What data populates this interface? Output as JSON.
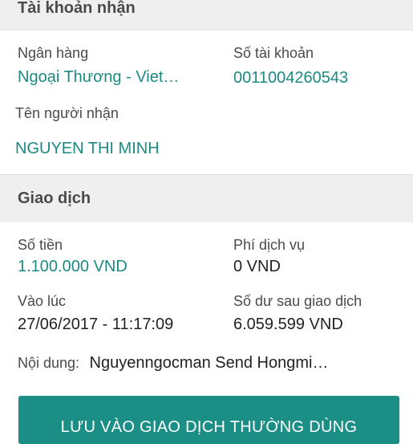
{
  "account_section": {
    "header": "Tài khoản nhận",
    "bank_label": "Ngân hàng",
    "bank_value": "Ngoại Thương - Viet…",
    "account_no_label": "Số tài khoản",
    "account_no_value": "0011004260543",
    "recipient_label": "Tên người nhận",
    "recipient_value": "NGUYEN THI MINH"
  },
  "transaction_section": {
    "header": "Giao dịch",
    "amount_label": "Số tiền",
    "amount_value": "1.100.000 VND",
    "fee_label": "Phí dịch vụ",
    "fee_value": "0 VND",
    "time_label": "Vào lúc",
    "time_value": "27/06/2017 - 11:17:09",
    "balance_label": "Số dư sau giao dịch",
    "balance_value": "6.059.599 VND",
    "content_label": "Nội dung:",
    "content_value": "Nguyenngocman Send Hongmi…"
  },
  "actions": {
    "save_label": "LƯU VÀO GIAO DỊCH THƯỜNG DÙNG"
  },
  "colors": {
    "accent": "#1b8f85",
    "value_green": "#1c8a83",
    "header_bg": "#efefef"
  }
}
